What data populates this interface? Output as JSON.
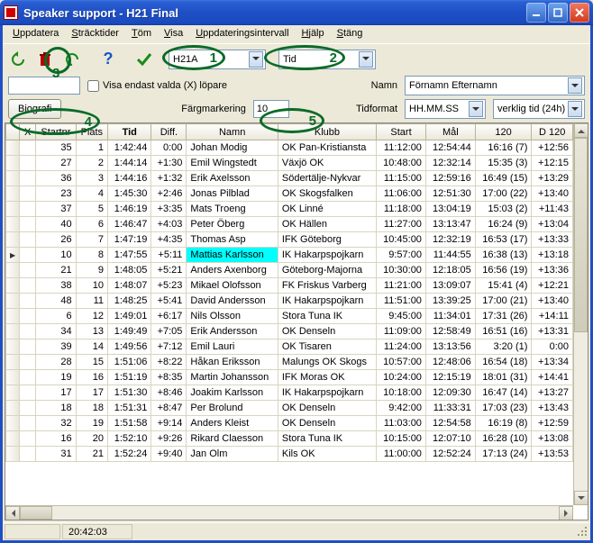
{
  "window": {
    "title": "Speaker support - H21 Final"
  },
  "menu": {
    "uppdatera": "Uppdatera",
    "stracktider": "Sträcktider",
    "tom": "Töm",
    "visa": "Visa",
    "uppdateringsintervall": "Uppdateringsintervall",
    "hjalp": "Hjälp",
    "stang": "Stäng"
  },
  "toolbar": {
    "class_combo": "H21A",
    "sort_combo": "Tid"
  },
  "filters": {
    "checkbox_label": "Visa endast valda (X) löpare",
    "namn_label": "Namn",
    "namn_combo": "Förnamn Efternamn",
    "tidformat_label": "Tidformat",
    "tidformat_combo": "HH.MM.SS",
    "tidtype_combo": "verklig tid (24h)",
    "biografi_btn": "Biografi",
    "fargmarkering_label": "Färgmarkering",
    "fargmarkering_value": "10"
  },
  "columns": {
    "x": "X",
    "startnr": "Startnr",
    "plats": "Plats",
    "tid": "Tid",
    "diff": "Diff.",
    "namn": "Namn",
    "klubb": "Klubb",
    "start": "Start",
    "mal": "Mål",
    "c120": "120",
    "d120": "D 120"
  },
  "rows": [
    {
      "startnr": 35,
      "plats": 1,
      "tid": "1:42:44",
      "diff": "0:00",
      "namn": "Johan Modig",
      "klubb": "OK Pan-Kristiansta",
      "start": "11:12:00",
      "mal": "12:54:44",
      "c120": "16:16 (7)",
      "d120": "+12:56"
    },
    {
      "startnr": 27,
      "plats": 2,
      "tid": "1:44:14",
      "diff": "+1:30",
      "namn": "Emil Wingstedt",
      "klubb": "Växjö OK",
      "start": "10:48:00",
      "mal": "12:32:14",
      "c120": "15:35 (3)",
      "d120": "+12:15"
    },
    {
      "startnr": 36,
      "plats": 3,
      "tid": "1:44:16",
      "diff": "+1:32",
      "namn": "Erik Axelsson",
      "klubb": "Södertälje-Nykvar",
      "start": "11:15:00",
      "mal": "12:59:16",
      "c120": "16:49 (15)",
      "d120": "+13:29"
    },
    {
      "startnr": 23,
      "plats": 4,
      "tid": "1:45:30",
      "diff": "+2:46",
      "namn": "Jonas Pilblad",
      "klubb": "OK Skogsfalken",
      "start": "11:06:00",
      "mal": "12:51:30",
      "c120": "17:00 (22)",
      "d120": "+13:40"
    },
    {
      "startnr": 37,
      "plats": 5,
      "tid": "1:46:19",
      "diff": "+3:35",
      "namn": "Mats Troeng",
      "klubb": "OK Linné",
      "start": "11:18:00",
      "mal": "13:04:19",
      "c120": "15:03 (2)",
      "d120": "+11:43"
    },
    {
      "startnr": 40,
      "plats": 6,
      "tid": "1:46:47",
      "diff": "+4:03",
      "namn": "Peter Öberg",
      "klubb": "OK Hällen",
      "start": "11:27:00",
      "mal": "13:13:47",
      "c120": "16:24 (9)",
      "d120": "+13:04"
    },
    {
      "startnr": 26,
      "plats": 7,
      "tid": "1:47:19",
      "diff": "+4:35",
      "namn": "Thomas Asp",
      "klubb": "IFK Göteborg",
      "start": "10:45:00",
      "mal": "12:32:19",
      "c120": "16:53 (17)",
      "d120": "+13:33"
    },
    {
      "startnr": 10,
      "plats": 8,
      "tid": "1:47:55",
      "diff": "+5:11",
      "namn": "Mattias Karlsson",
      "klubb": "IK Hakarpspojkarn",
      "start": "9:57:00",
      "mal": "11:44:55",
      "c120": "16:38 (13)",
      "d120": "+13:18",
      "highlight": true,
      "selected": true
    },
    {
      "startnr": 21,
      "plats": 9,
      "tid": "1:48:05",
      "diff": "+5:21",
      "namn": "Anders Axenborg",
      "klubb": "Göteborg-Majorna",
      "start": "10:30:00",
      "mal": "12:18:05",
      "c120": "16:56 (19)",
      "d120": "+13:36"
    },
    {
      "startnr": 38,
      "plats": 10,
      "tid": "1:48:07",
      "diff": "+5:23",
      "namn": "Mikael Olofsson",
      "klubb": "FK Friskus Varberg",
      "start": "11:21:00",
      "mal": "13:09:07",
      "c120": "15:41 (4)",
      "d120": "+12:21"
    },
    {
      "startnr": 48,
      "plats": 11,
      "tid": "1:48:25",
      "diff": "+5:41",
      "namn": "David Andersson",
      "klubb": "IK Hakarpspojkarn",
      "start": "11:51:00",
      "mal": "13:39:25",
      "c120": "17:00 (21)",
      "d120": "+13:40"
    },
    {
      "startnr": 6,
      "plats": 12,
      "tid": "1:49:01",
      "diff": "+6:17",
      "namn": "Nils Olsson",
      "klubb": "Stora Tuna IK",
      "start": "9:45:00",
      "mal": "11:34:01",
      "c120": "17:31 (26)",
      "d120": "+14:11"
    },
    {
      "startnr": 34,
      "plats": 13,
      "tid": "1:49:49",
      "diff": "+7:05",
      "namn": "Erik Andersson",
      "klubb": "OK Denseln",
      "start": "11:09:00",
      "mal": "12:58:49",
      "c120": "16:51 (16)",
      "d120": "+13:31"
    },
    {
      "startnr": 39,
      "plats": 14,
      "tid": "1:49:56",
      "diff": "+7:12",
      "namn": "Emil Lauri",
      "klubb": "OK Tisaren",
      "start": "11:24:00",
      "mal": "13:13:56",
      "c120": "3:20 (1)",
      "d120": "0:00"
    },
    {
      "startnr": 28,
      "plats": 15,
      "tid": "1:51:06",
      "diff": "+8:22",
      "namn": "Håkan Eriksson",
      "klubb": "Malungs OK Skogs",
      "start": "10:57:00",
      "mal": "12:48:06",
      "c120": "16:54 (18)",
      "d120": "+13:34"
    },
    {
      "startnr": 19,
      "plats": 16,
      "tid": "1:51:19",
      "diff": "+8:35",
      "namn": "Martin Johansson",
      "klubb": "IFK Moras OK",
      "start": "10:24:00",
      "mal": "12:15:19",
      "c120": "18:01 (31)",
      "d120": "+14:41"
    },
    {
      "startnr": 17,
      "plats": 17,
      "tid": "1:51:30",
      "diff": "+8:46",
      "namn": "Joakim Karlsson",
      "klubb": "IK Hakarpspojkarn",
      "start": "10:18:00",
      "mal": "12:09:30",
      "c120": "16:47 (14)",
      "d120": "+13:27"
    },
    {
      "startnr": 18,
      "plats": 18,
      "tid": "1:51:31",
      "diff": "+8:47",
      "namn": "Per Brolund",
      "klubb": "OK Denseln",
      "start": "9:42:00",
      "mal": "11:33:31",
      "c120": "17:03 (23)",
      "d120": "+13:43"
    },
    {
      "startnr": 32,
      "plats": 19,
      "tid": "1:51:58",
      "diff": "+9:14",
      "namn": "Anders Kleist",
      "klubb": "OK Denseln",
      "start": "11:03:00",
      "mal": "12:54:58",
      "c120": "16:19 (8)",
      "d120": "+12:59"
    },
    {
      "startnr": 16,
      "plats": 20,
      "tid": "1:52:10",
      "diff": "+9:26",
      "namn": "Rikard Claesson",
      "klubb": "Stora Tuna IK",
      "start": "10:15:00",
      "mal": "12:07:10",
      "c120": "16:28 (10)",
      "d120": "+13:08"
    },
    {
      "startnr": 31,
      "plats": 21,
      "tid": "1:52:24",
      "diff": "+9:40",
      "namn": "Jan Olm",
      "klubb": "Kils OK",
      "start": "11:00:00",
      "mal": "12:52:24",
      "c120": "17:13 (24)",
      "d120": "+13:53"
    }
  ],
  "status": {
    "time": "20:42:03"
  },
  "annotations": {
    "n1": "1",
    "n2": "2",
    "n3": "3",
    "n4": "4",
    "n5": "5"
  }
}
